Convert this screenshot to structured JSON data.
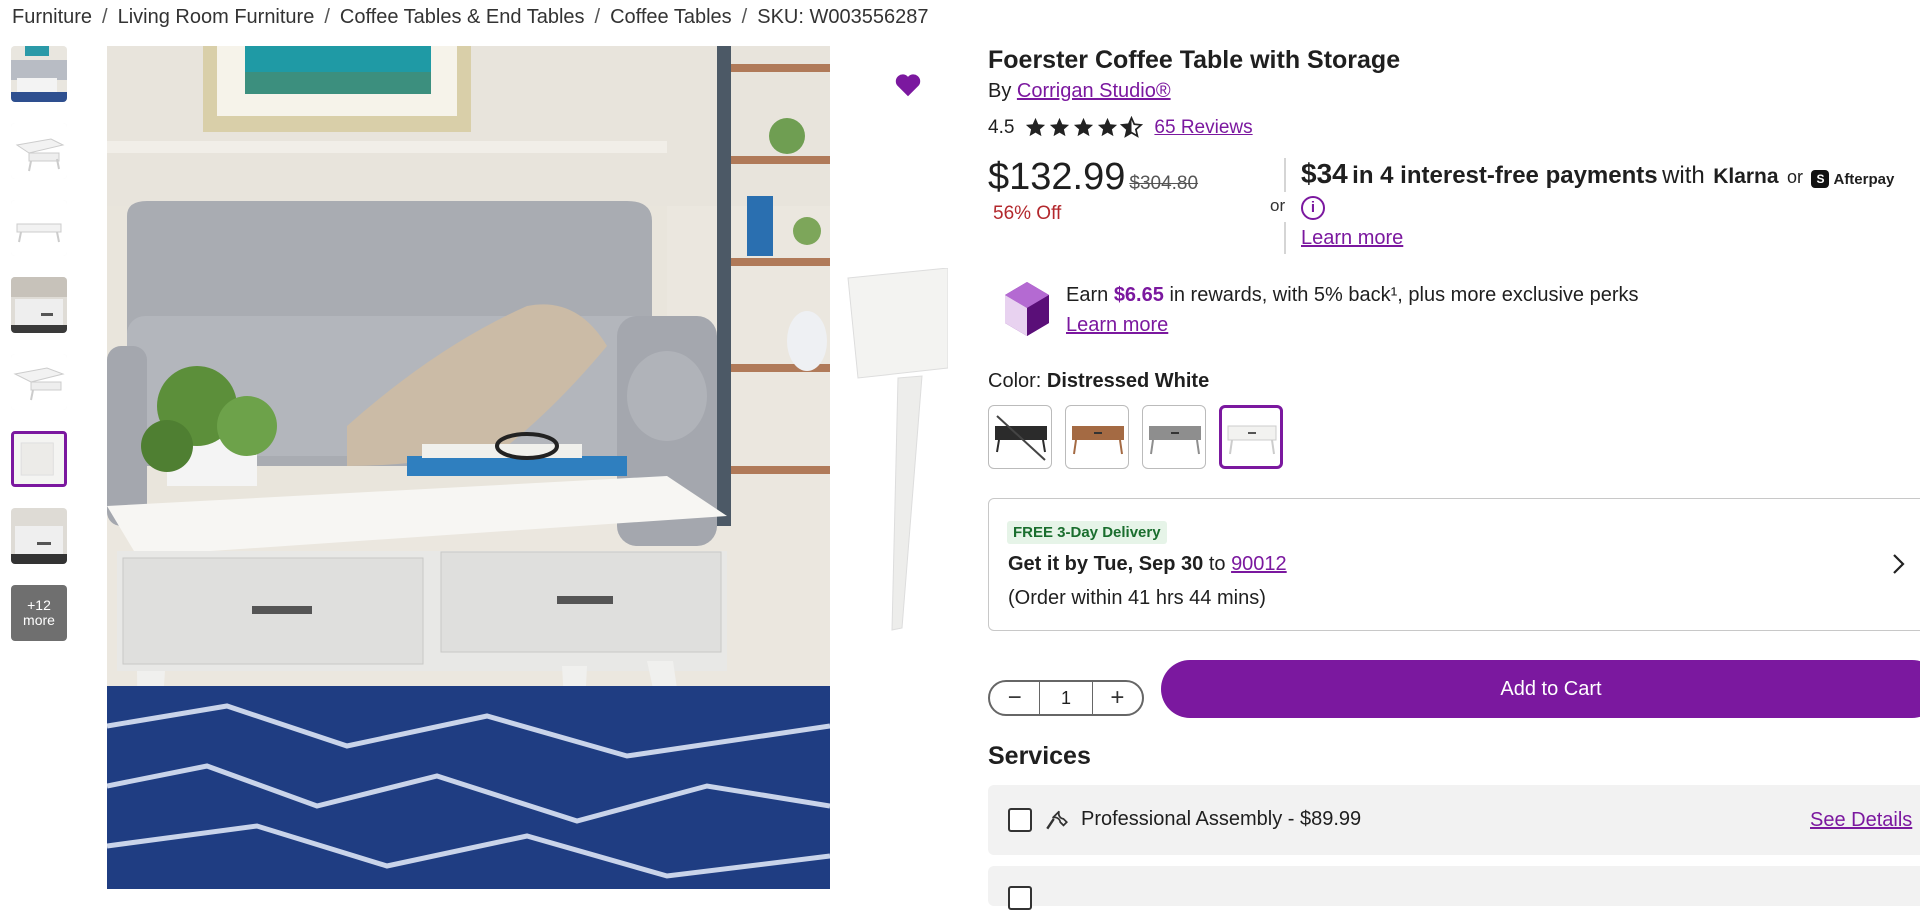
{
  "breadcrumb": {
    "items": [
      "Furniture",
      "Living Room Furniture",
      "Coffee Tables & End Tables",
      "Coffee Tables"
    ],
    "separator": "/",
    "sku": "SKU: W003556287"
  },
  "gallery": {
    "more_count": "+12",
    "more_label": "more",
    "selected_index": 5
  },
  "product": {
    "title": "Foerster Coffee Table with Storage",
    "by_prefix": "By",
    "brand": "Corrigan Studio®",
    "rating": "4.5",
    "rating_value": 4.5,
    "reviews": "65 Reviews"
  },
  "pricing": {
    "price": "$132.99",
    "original_price": "$304.80",
    "discount": "56% Off",
    "or": "or",
    "installment_amount": "$34",
    "installment_text": "in 4 interest-free payments",
    "with": "with",
    "klarna": "Klarna",
    "or2": "or",
    "afterpay": "Afterpay",
    "info_glyph": "i",
    "learn_more": "Learn more"
  },
  "rewards": {
    "earn": "Earn",
    "amount": "$6.65",
    "text": "in rewards, with 5% back¹, plus more exclusive perks",
    "learn_more": "Learn more"
  },
  "color": {
    "label": "Color:",
    "selected": "Distressed White",
    "selected_index": 3
  },
  "delivery": {
    "badge": "FREE 3-Day Delivery",
    "getit_prefix": "Get it by",
    "date": "Tue, Sep 30",
    "to": "to",
    "zip": "90012",
    "order_within": "(Order within 41 hrs 44 mins)"
  },
  "cart": {
    "minus": "−",
    "quantity": "1",
    "plus": "+",
    "add_to_cart": "Add to Cart"
  },
  "services": {
    "title": "Services",
    "items": [
      {
        "label": "Professional Assembly - $89.99",
        "details": "See Details"
      }
    ]
  },
  "colors": {
    "accent": "#7b189f",
    "discount": "#b3282d",
    "free_badge_bg": "#e6f4e8",
    "free_badge_text": "#1a6e2e"
  },
  "icons": [
    "heart-icon",
    "star-icon",
    "half-star-icon",
    "info-icon",
    "rewards-gem-icon",
    "chevron-right-icon",
    "wrench-icon",
    "checkbox-icon",
    "minus-icon",
    "plus-icon"
  ]
}
